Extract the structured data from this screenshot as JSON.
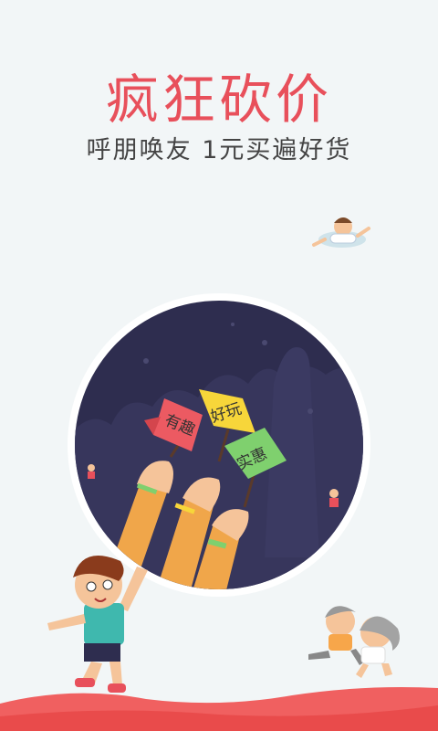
{
  "splash": {
    "title": "疯狂砍价",
    "subtitle": "呼朋唤友 1元买遍好货",
    "flags": [
      "有趣",
      "好玩",
      "实惠"
    ]
  },
  "colors": {
    "background": "#f2f6f7",
    "title": "#e8505b",
    "circle": "#2e2d4f",
    "flag_red": "#ec5a62",
    "flag_yellow": "#f7d63a",
    "flag_green": "#7fd06e",
    "ground_red": "#e94b4b"
  }
}
